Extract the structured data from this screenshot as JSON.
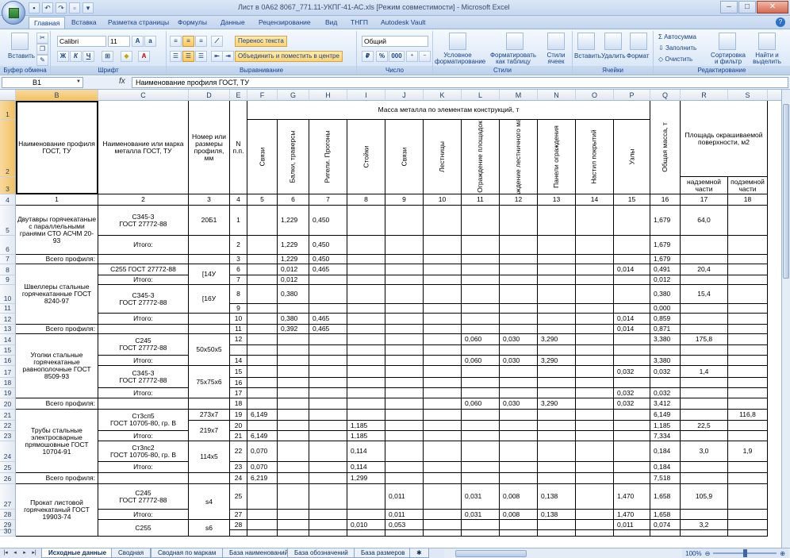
{
  "window": {
    "title": "Лист в 0А62 8067_771.11-УКПГ-41-АС.xls [Режим совместимости] - Microsoft Excel"
  },
  "tabs": [
    "Главная",
    "Вставка",
    "Разметка страницы",
    "Формулы",
    "Данные",
    "Рецензирование",
    "Вид",
    "ТНГП",
    "Autodesk Vault"
  ],
  "ribbon": {
    "clipboard": {
      "label": "Буфер обмена",
      "paste": "Вставить"
    },
    "font": {
      "label": "Шрифт",
      "name": "Calibri",
      "size": "11"
    },
    "alignment": {
      "label": "Выравнивание",
      "wrap": "Перенос текста",
      "merge": "Объединить и поместить в центре"
    },
    "number": {
      "label": "Число",
      "format": "Общий",
      "percent": "%",
      "thousands": "000"
    },
    "styles": {
      "label": "Стили",
      "conditional": "Условное форматирование",
      "as_table": "Форматировать как таблицу",
      "cell_styles": "Стили ячеек"
    },
    "cells": {
      "label": "Ячейки",
      "insert": "Вставить",
      "delete": "Удалить",
      "format": "Формат"
    },
    "editing": {
      "label": "Редактирование",
      "autosum": "Автосумма",
      "fill": "Заполнить",
      "clear": "Очистить",
      "sort": "Сортировка и фильтр",
      "find": "Найти и выделить"
    }
  },
  "formula_bar": {
    "name_box": "B1",
    "formula": "Наименование профиля ГОСТ, ТУ"
  },
  "columns": [
    "B",
    "C",
    "D",
    "E",
    "F",
    "G",
    "H",
    "I",
    "J",
    "K",
    "L",
    "M",
    "N",
    "O",
    "P",
    "Q",
    "R",
    "S"
  ],
  "rows": [
    "1",
    "2",
    "3",
    "4",
    "5",
    "6",
    "7",
    "8",
    "9",
    "10",
    "11",
    "12",
    "13",
    "14",
    "15",
    "16",
    "17",
    "18",
    "19",
    "20",
    "21",
    "22",
    "23",
    "24",
    "25",
    "26",
    "27",
    "28",
    "29",
    "30"
  ],
  "header": {
    "name_profile": "Наименование профиля ГОСТ, ТУ",
    "name_grade": "Наименование или марка металла ГОСТ, ТУ",
    "profile_size": "Номер или размеры профиля, мм",
    "num": "N п.п.",
    "mass_title": "Масса металла по элементам конструкций, т",
    "elements": [
      "Связи",
      "Балки, траверсы",
      "Ригели. Прогоны",
      "Стойки",
      "Связи",
      "Лестницы",
      "Ограждение площадок",
      "Ограждение лестничного марша",
      "Панели ограждения",
      "Настил покрытий",
      "Узлы"
    ],
    "total_mass": "Общая масса, т",
    "paint_area": "Площадь окрашиваемой поверхности, м2",
    "above_ground": "надземной части",
    "underground": "подземной части",
    "col_numbers": [
      "1",
      "2",
      "3",
      "4",
      "5",
      "6",
      "7",
      "8",
      "9",
      "10",
      "11",
      "12",
      "13",
      "14",
      "15",
      "16",
      "17",
      "18"
    ]
  },
  "data": {
    "r5": {
      "b": "Двутавры горячекатаные с параллельными гранями СТО АСЧМ 20-93",
      "c": "С345-3\nГОСТ 27772-88",
      "d": "20Б1",
      "e": "1",
      "g": "1,229",
      "h": "0,450",
      "q": "1,679",
      "r": "64,0"
    },
    "r6": {
      "c": "Итого:",
      "e": "2",
      "g": "1,229",
      "h": "0,450",
      "q": "1,679"
    },
    "r7": {
      "b": "Всего профиля:",
      "e": "3",
      "g": "1,229",
      "h": "0,450",
      "q": "1,679"
    },
    "r8": {
      "b": "Швеллеры стальные горячекатанные ГОСТ 8240-97",
      "c": "С255 ГОСТ 27772-88",
      "d": "[14У",
      "e": "6",
      "g": "0,012",
      "h": "0,465",
      "p": "0,014",
      "q": "0,491",
      "r": "20,4"
    },
    "r9": {
      "c": "Итого:",
      "e": "7",
      "g": "0,012",
      "q": "0,012"
    },
    "r10": {
      "c": "С345-3\nГОСТ 27772-88",
      "d": "[16У",
      "e": "8",
      "g": "0,380",
      "q": "0,380",
      "r": "15,4"
    },
    "r11": {
      "e": "9",
      "q": "0,000"
    },
    "r12": {
      "c": "Итого:",
      "e": "10",
      "g": "0,380",
      "h": "0,465",
      "p": "0,014",
      "q": "0,859"
    },
    "r13": {
      "b": "Всего профиля:",
      "e": "11",
      "g": "0,392",
      "h": "0,465",
      "p": "0,014",
      "q": "0,871"
    },
    "r14": {
      "b": "Уголки стальные горячекатаные равнополочные ГОСТ 8509-93",
      "c": "С245\nГОСТ 27772-88",
      "d": "50х50х5",
      "e": "12",
      "l": "0,060",
      "m": "0,030",
      "n": "3,290",
      "q": "3,380",
      "r": "175,8"
    },
    "r16": {
      "c": "Итого:",
      "e": "14",
      "l": "0,060",
      "m": "0,030",
      "n": "3,290",
      "q": "3,380"
    },
    "r17": {
      "c": "С345-3\nГОСТ 27772-88",
      "d": "75х75х6",
      "e": "15",
      "p": "0,032",
      "q": "0,032",
      "r": "1,4"
    },
    "r18": {
      "e": "16"
    },
    "r19": {
      "c": "Итого:",
      "e": "17",
      "p": "0,032",
      "q": "0,032"
    },
    "r20": {
      "b": "Всего профиля:",
      "e": "18",
      "l": "0,060",
      "m": "0,030",
      "n": "3,290",
      "p": "0,032",
      "q": "3,412"
    },
    "r21": {
      "b": "Трубы стальные электросварные прямошовные ГОСТ 10704-91",
      "c": "Ст3сп5\nГОСТ 10705-80, гр. В",
      "d": "273х7",
      "e": "19",
      "f": "6,149",
      "q": "6,149",
      "s": "116,8"
    },
    "r22": {
      "d": "219х7",
      "e": "20",
      "i": "1,185",
      "q": "1,185",
      "r": "22,5"
    },
    "r23": {
      "c": "Итого:",
      "e": "21",
      "f": "6,149",
      "i": "1,185",
      "q": "7,334"
    },
    "r24": {
      "c": "Ст3пс2\nГОСТ 10705-80, гр. В",
      "d": "114х5",
      "e": "22",
      "f": "0,070",
      "i": "0,114",
      "q": "0,184",
      "r": "3,0",
      "s": "1,9"
    },
    "r25": {
      "c": "Итого:",
      "e": "23",
      "f": "0,070",
      "i": "0,114",
      "q": "0,184"
    },
    "r26": {
      "b": "Всего профиля:",
      "e": "24",
      "f": "6,219",
      "i": "1,299",
      "q": "7,518"
    },
    "r27": {
      "b": "Прокат листовой горячекатаный ГОСТ 19903-74",
      "c": "С245\nГОСТ 27772-88",
      "d": "s4",
      "e": "25",
      "j": "0,011",
      "l": "0,031",
      "m": "0,008",
      "n": "0,138",
      "p": "1,470",
      "q": "1,658",
      "r": "105,9"
    },
    "r28": {
      "c": "Итого:",
      "e": "27",
      "j": "0,011",
      "l": "0,031",
      "m": "0,008",
      "n": "0,138",
      "p": "1,470",
      "q": "1,658"
    },
    "r29": {
      "c": "С255",
      "d": "s6",
      "e": "28",
      "i": "0,010",
      "j": "0,053",
      "p": "0,011",
      "q": "0,074",
      "r": "3,2"
    }
  },
  "sheets": [
    "Исходные данные",
    "Сводная",
    "Сводная по маркам",
    "База наименований",
    "База обозначений",
    "База размеров"
  ],
  "status": {
    "zoom": "100%"
  }
}
